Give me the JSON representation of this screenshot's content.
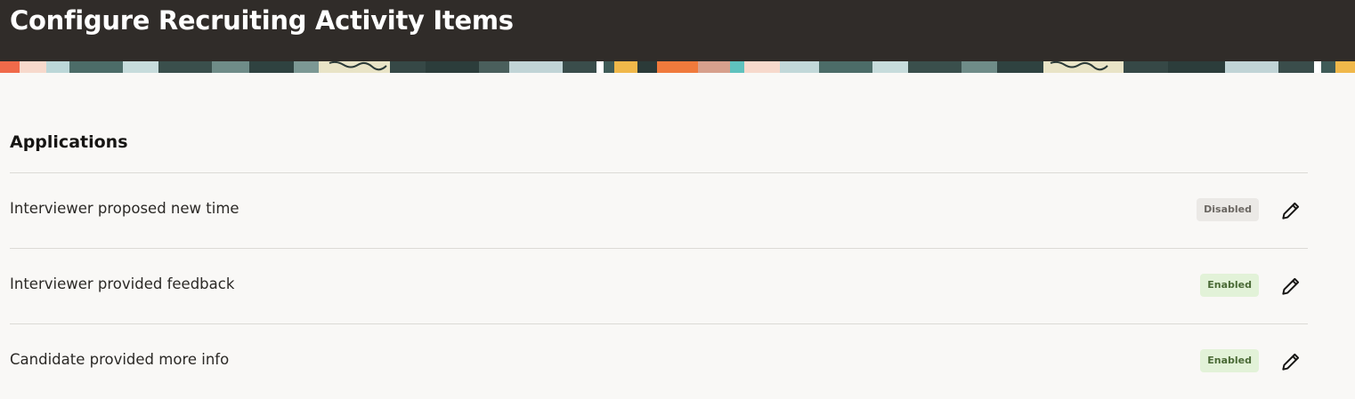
{
  "header": {
    "title": "Configure Recruiting Activity Items"
  },
  "section": {
    "heading": "Applications"
  },
  "items": [
    {
      "label": "Interviewer proposed new time",
      "status": "Disabled"
    },
    {
      "label": "Interviewer provided feedback",
      "status": "Enabled"
    },
    {
      "label": "Candidate provided more info",
      "status": "Enabled"
    }
  ],
  "icons": {
    "edit": "pencil-icon"
  },
  "colors": {
    "header_bg": "#302c29",
    "page_bg": "#f9f8f6",
    "enabled_badge": "#e2f2d8",
    "disabled_badge": "#ebe9e6"
  }
}
